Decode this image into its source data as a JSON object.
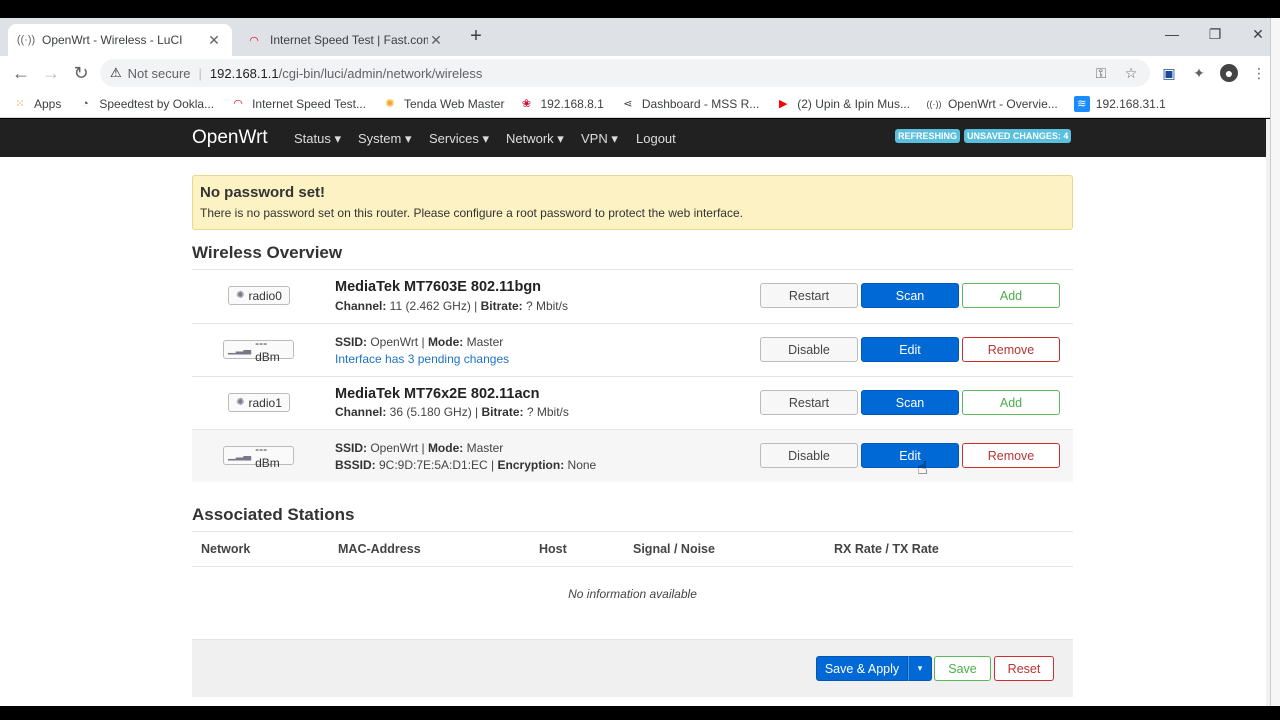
{
  "browser": {
    "tabs": [
      {
        "title": "OpenWrt - Wireless - LuCI",
        "favicon": "wireless-icon"
      },
      {
        "title": "Internet Speed Test | Fast.com",
        "favicon": "speedometer-icon"
      }
    ],
    "address": {
      "security_label": "Not secure",
      "url_host": "192.168.1.1",
      "url_path": "/cgi-bin/luci/admin/network/wireless"
    },
    "bookmarks": [
      {
        "label": "Apps",
        "icon": "apps-grid-icon"
      },
      {
        "label": "Speedtest by Ookla...",
        "icon": "speedtest-icon"
      },
      {
        "label": "Internet Speed Test...",
        "icon": "fast-icon"
      },
      {
        "label": "Tenda Web Master",
        "icon": "tenda-icon"
      },
      {
        "label": "192.168.8.1",
        "icon": "huawei-icon"
      },
      {
        "label": "Dashboard - MSS R...",
        "icon": "dashboard-icon"
      },
      {
        "label": "(2) Upin & Ipin Mus...",
        "icon": "youtube-icon"
      },
      {
        "label": "OpenWrt - Overvie...",
        "icon": "wireless-icon"
      },
      {
        "label": "192.168.31.1",
        "icon": "wifi-icon"
      }
    ]
  },
  "header": {
    "brand": "OpenWrt",
    "menu": [
      "Status",
      "System",
      "Services",
      "Network",
      "VPN",
      "Logout"
    ],
    "badges": {
      "refreshing": "REFRESHING",
      "unsaved": "UNSAVED CHANGES: 4"
    }
  },
  "alert": {
    "title": "No password set!",
    "message": "There is no password set on this router. Please configure a root password to protect the web interface."
  },
  "wireless": {
    "title": "Wireless Overview",
    "rows": [
      {
        "badge": "radio0",
        "title": "MediaTek MT7603E 802.11bgn",
        "channel_label": "Channel:",
        "channel": " 11 (2.462 GHz) | ",
        "bitrate_label": "Bitrate:",
        "bitrate": " ? Mbit/s",
        "buttons": [
          "Restart",
          "Scan",
          "Add"
        ]
      },
      {
        "badge": "--- dBm",
        "ssid_label": "SSID:",
        "ssid": " OpenWrt | ",
        "mode_label": "Mode:",
        "mode": " Master",
        "note": "Interface has 3 pending changes",
        "buttons": [
          "Disable",
          "Edit",
          "Remove"
        ]
      },
      {
        "badge": "radio1",
        "title": "MediaTek MT76x2E 802.11acn",
        "channel_label": "Channel:",
        "channel": " 36 (5.180 GHz) | ",
        "bitrate_label": "Bitrate:",
        "bitrate": " ? Mbit/s",
        "buttons": [
          "Restart",
          "Scan",
          "Add"
        ]
      },
      {
        "badge": "--- dBm",
        "ssid_label": "SSID:",
        "ssid": " OpenWrt | ",
        "mode_label": "Mode:",
        "mode": " Master",
        "bssid_label": "BSSID:",
        "bssid": " 9C:9D:7E:5A:D1:EC | ",
        "enc_label": "Encryption:",
        "enc": " None",
        "buttons": [
          "Disable",
          "Edit",
          "Remove"
        ]
      }
    ]
  },
  "stations": {
    "title": "Associated Stations",
    "columns": [
      "Network",
      "MAC-Address",
      "Host",
      "Signal / Noise",
      "RX Rate / TX Rate"
    ],
    "empty": "No information available"
  },
  "actions": {
    "save_apply": "Save & Apply",
    "save": "Save",
    "reset": "Reset"
  },
  "colors": {
    "primary": "#0069d6",
    "positive": "#5cb85c",
    "negative": "#c9302c",
    "alert_bg": "#fcf2c3",
    "header_bg": "#212121"
  }
}
